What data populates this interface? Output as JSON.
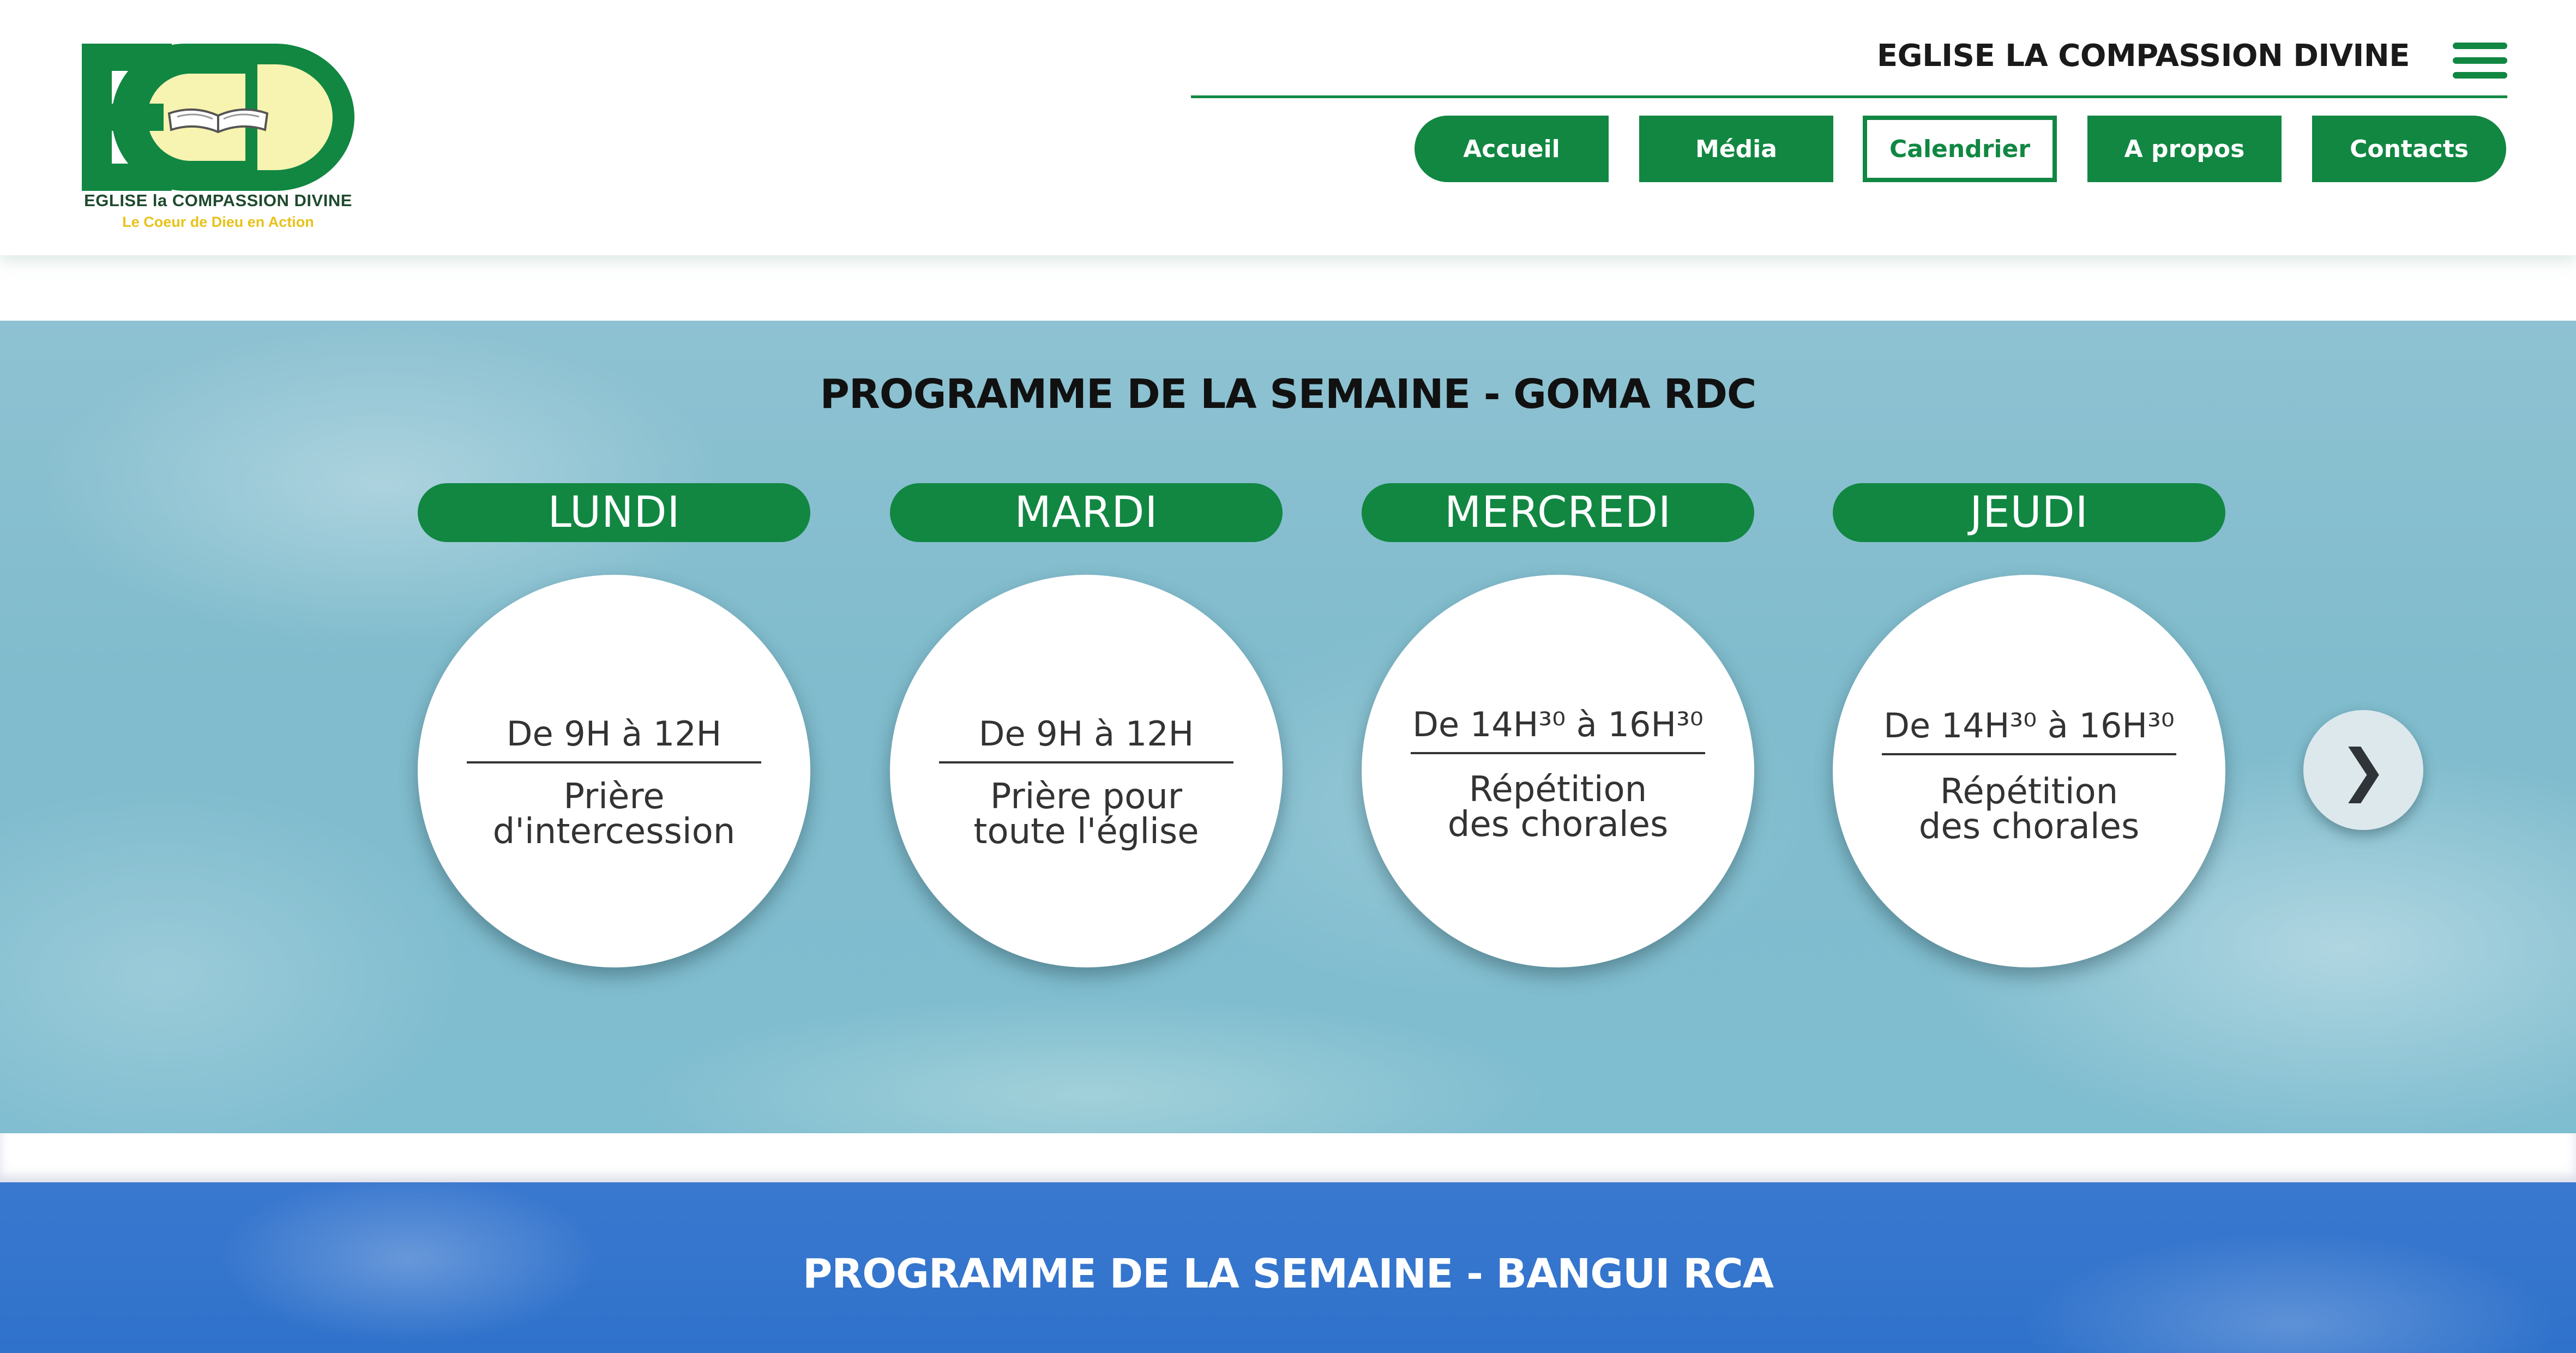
{
  "header": {
    "logo": {
      "letters": "ECD",
      "name": "EGLISE la COMPASSION DIVINE",
      "tagline": "Le Coeur de Dieu en Action"
    },
    "site_title": "EGLISE LA COMPASSION DIVINE",
    "menu_icon": "hamburger-menu-icon"
  },
  "nav": {
    "items": [
      {
        "label": "Accueil",
        "active": false
      },
      {
        "label": "Média",
        "active": false
      },
      {
        "label": "Calendrier",
        "active": true
      },
      {
        "label": "A propos",
        "active": false
      },
      {
        "label": "Contacts",
        "active": false
      }
    ]
  },
  "goma": {
    "title": "PROGRAMME DE LA SEMAINE - GOMA RDC",
    "days": [
      {
        "day": "LUNDI",
        "time": "De 9H à 12H",
        "activity_line1": "Prière",
        "activity_line2": "d'intercession"
      },
      {
        "day": "MARDI",
        "time": "De 9H à 12H",
        "activity_line1": "Prière pour",
        "activity_line2": "toute l'église"
      },
      {
        "day": "MERCREDI",
        "time": "De 14H³⁰ à 16H³⁰",
        "activity_line1": "Répétition",
        "activity_line2": "des chorales"
      },
      {
        "day": "JEUDI",
        "time": "De 14H³⁰ à 16H³⁰",
        "activity_line1": "Répétition",
        "activity_line2": "des chorales"
      }
    ],
    "next_symbol": "❯"
  },
  "bangui": {
    "title": "PROGRAMME DE LA SEMAINE - BANGUI RCA"
  },
  "colors": {
    "brand_green": "#118742",
    "logo_yellow": "#f7f3b0",
    "sky_light": "#8ec2d2",
    "sky_blue": "#2f72cb"
  }
}
